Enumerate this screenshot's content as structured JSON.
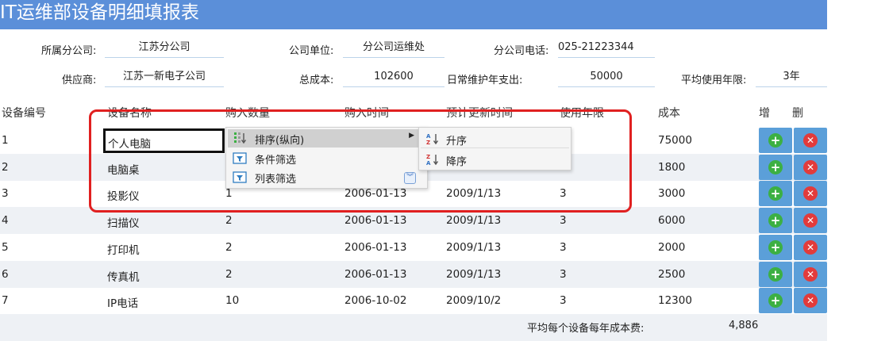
{
  "title": "IT运维部设备明细填报表",
  "form": {
    "branch_label": "所属分公司:",
    "branch_value": "江苏分公司",
    "unit_label": "公司单位:",
    "unit_value": "分公司运维处",
    "phone_label": "分公司电话:",
    "phone_value": "025-21223344",
    "supplier_label": "供应商:",
    "supplier_value": "江苏一新电子公司",
    "total_label": "总成本:",
    "total_value": "102600",
    "maint_label": "日常维护年支出:",
    "maint_value": "50000",
    "years_label": "平均使用年限:",
    "years_value": "3年"
  },
  "table": {
    "headers": [
      "设备编号",
      "设备名称",
      "购入数量",
      "购入时间",
      "预计更新时间",
      "使用年限",
      "成本",
      "增",
      "删"
    ],
    "rows": [
      {
        "id": "1",
        "name": "个人电脑",
        "qty": "",
        "buy": "",
        "renew": "",
        "years": "",
        "cost": "75000"
      },
      {
        "id": "2",
        "name": "电脑桌",
        "qty": "",
        "buy": "",
        "renew": "",
        "years": "",
        "cost": "1800"
      },
      {
        "id": "3",
        "name": "投影仪",
        "qty": "1",
        "buy": "2006-01-13",
        "renew": "2009/1/13",
        "years": "3",
        "cost": "3000"
      },
      {
        "id": "4",
        "name": "扫描仪",
        "qty": "2",
        "buy": "2006-01-13",
        "renew": "2009/1/13",
        "years": "3",
        "cost": "6000"
      },
      {
        "id": "5",
        "name": "打印机",
        "qty": "2",
        "buy": "2006-01-13",
        "renew": "2009/1/13",
        "years": "3",
        "cost": "2000"
      },
      {
        "id": "6",
        "name": "传真机",
        "qty": "2",
        "buy": "2006-01-13",
        "renew": "2009/1/13",
        "years": "3",
        "cost": "2500"
      },
      {
        "id": "7",
        "name": "IP电话",
        "qty": "10",
        "buy": "2006-10-02",
        "renew": "2009/10/2",
        "years": "3",
        "cost": "12300"
      }
    ]
  },
  "footer": {
    "label": "平均每个设备每年成本费:",
    "value": "4,886"
  },
  "context_menu": {
    "items": [
      "排序(纵向)",
      "条件筛选",
      "列表筛选"
    ],
    "submenu": [
      "升序",
      "降序"
    ]
  },
  "colors": {
    "header_blue": "#5b8fd9",
    "button_blue": "#5b9fd9",
    "add_green": "#3cb043",
    "delete_red": "#e23b3b",
    "highlight_frame": "#e02020"
  }
}
